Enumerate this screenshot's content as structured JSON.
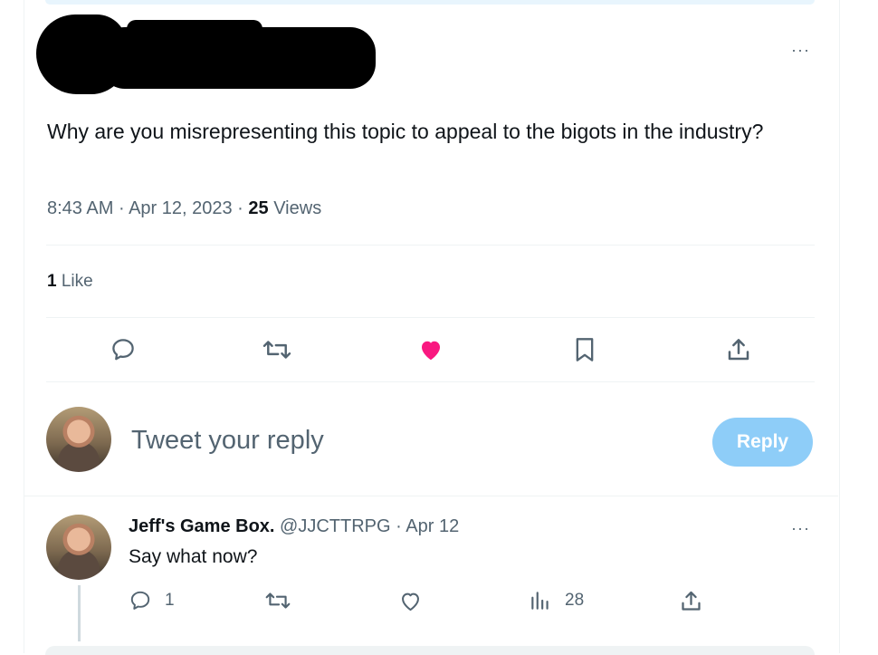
{
  "tweet": {
    "text": "Why are you misrepresenting this topic to appeal to the bigots in the industry?",
    "time": "8:43 AM",
    "date": "Apr 12, 2023",
    "views_count": "25",
    "views_label": "Views",
    "likes_count": "1",
    "likes_label": "Like",
    "more_label": "···"
  },
  "compose": {
    "placeholder": "Tweet your reply",
    "reply_button": "Reply"
  },
  "reply": {
    "name": "Jeff's Game Box.",
    "handle": "@JJCTTRPG",
    "dot": "·",
    "date": "Apr 12",
    "text": "Say what now?",
    "reply_count": "1",
    "views_count": "28",
    "more_label": "···"
  },
  "colors": {
    "like_active": "#f91880",
    "icon": "#536471",
    "reply_button_bg": "#8ecdf8"
  }
}
